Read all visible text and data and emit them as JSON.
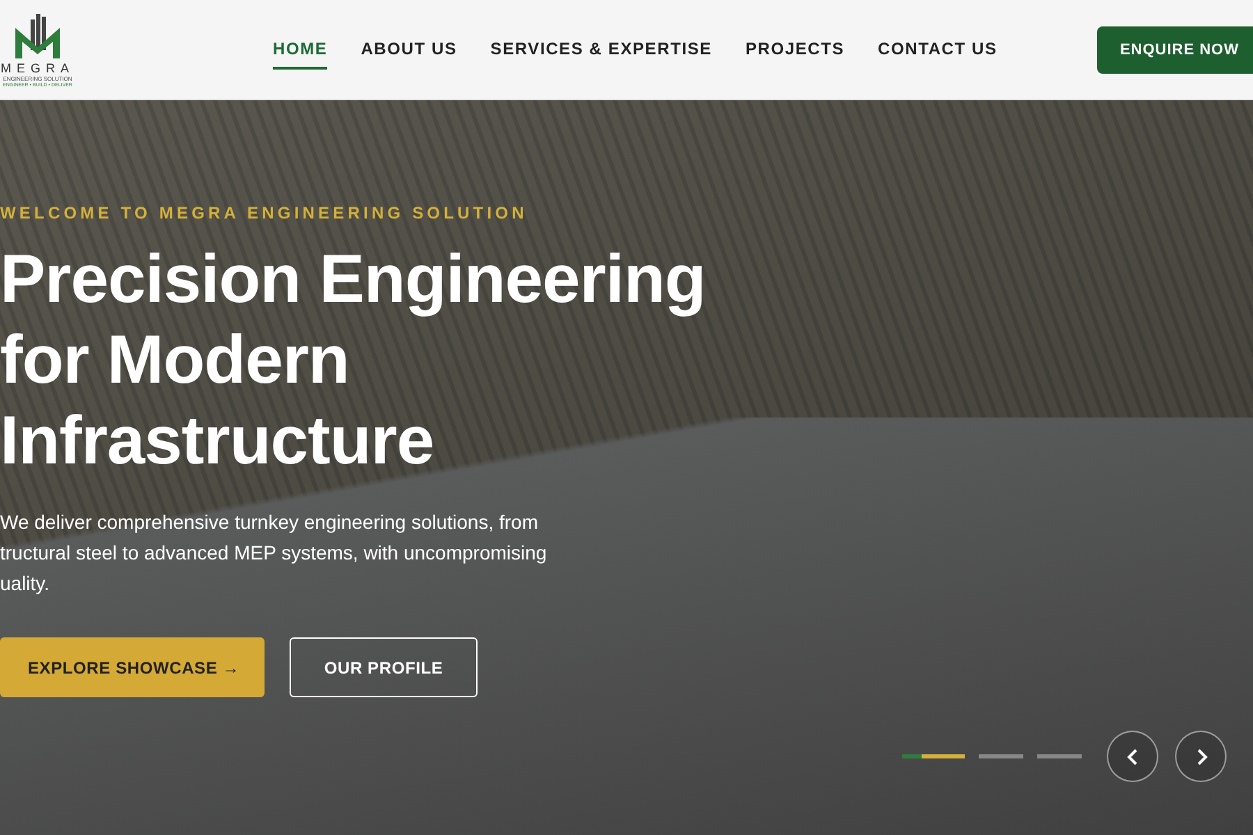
{
  "logo": {
    "name": "MEGRA",
    "subtitle": "ENGINEERING SOLUTION",
    "tagline": "ENGINEER • BUILD • DELIVER"
  },
  "nav": [
    {
      "label": "HOME",
      "selected": true
    },
    {
      "label": "ABOUT US",
      "selected": false
    },
    {
      "label": "SERVICES & EXPERTISE",
      "selected": false
    },
    {
      "label": "PROJECTS",
      "selected": false
    },
    {
      "label": "CONTACT US",
      "selected": false
    }
  ],
  "enquire_button": "ENQUIRE NOW",
  "hero": {
    "eyebrow": "WELCOME TO MEGRA ENGINEERING SOLUTION",
    "headline": [
      "Precision Engineering",
      "for Modern",
      "Infrastructure"
    ],
    "description": [
      "We deliver comprehensive turnkey engineering solutions, from",
      "tructural steel to advanced MEP systems, with uncompromising",
      "uality."
    ],
    "primary_button": "EXPLORE SHOWCASE →",
    "secondary_button": "OUR PROFILE",
    "slides": [
      {
        "selected": true
      },
      {
        "selected": false
      },
      {
        "selected": false
      }
    ]
  }
}
